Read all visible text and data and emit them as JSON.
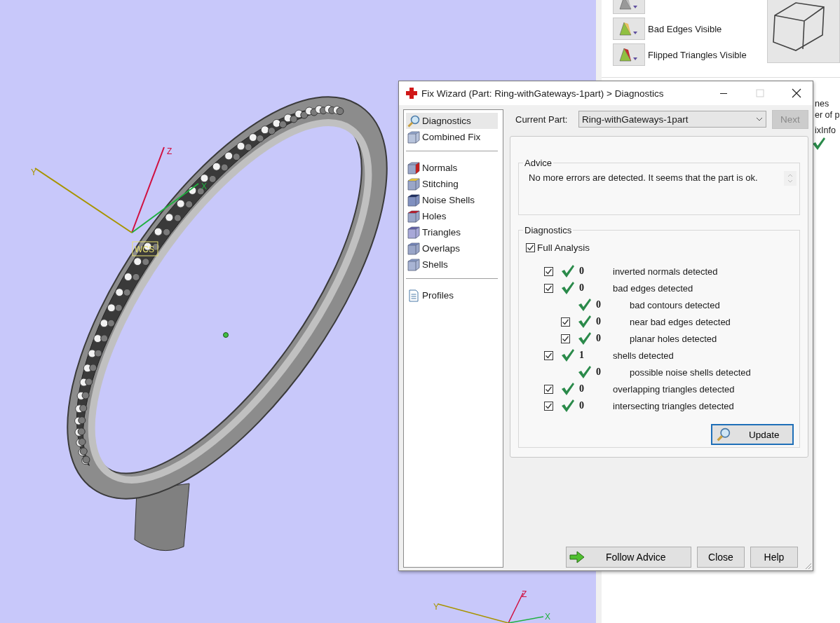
{
  "viewport": {
    "wcs_axes": {
      "labels": [
        "Z",
        "X",
        "Y"
      ],
      "tag": "WCS"
    },
    "corner_axes": {
      "labels": [
        "Z",
        "X",
        "Y"
      ]
    }
  },
  "side_panel": {
    "toggles": [
      {
        "kind": "shaded"
      },
      {
        "kind": "bad-edges",
        "label": "Bad Edges Visible"
      },
      {
        "kind": "flipped",
        "label": "Flipped Triangles Visible"
      }
    ],
    "fragments": [
      "nes",
      "er of p"
    ],
    "column_header": "ixInfo",
    "status_ok": true
  },
  "dialog": {
    "title": "Fix Wizard (Part: Ring-withGateways-1part) > Diagnostics",
    "maximize_disabled": true,
    "nav_groups": [
      [
        {
          "label": "Diagnostics",
          "kind": "search",
          "selected": true
        },
        {
          "label": "Combined Fix",
          "kind": "stack",
          "selected": false
        }
      ],
      [
        {
          "label": "Normals",
          "kind": "normals",
          "selected": false
        },
        {
          "label": "Stitching",
          "kind": "stitching",
          "selected": false
        },
        {
          "label": "Noise Shells",
          "kind": "noise",
          "selected": false
        },
        {
          "label": "Holes",
          "kind": "holes",
          "selected": false
        },
        {
          "label": "Triangles",
          "kind": "triangles",
          "selected": false
        },
        {
          "label": "Overlaps",
          "kind": "overlaps",
          "selected": false
        },
        {
          "label": "Shells",
          "kind": "shells",
          "selected": false
        }
      ],
      [
        {
          "label": "Profiles",
          "kind": "document",
          "selected": false
        }
      ]
    ],
    "current_part_label": "Current Part:",
    "current_part": "Ring-withGateways-1part",
    "next_button": {
      "label": "Next",
      "disabled": true
    },
    "advice": {
      "title": "Advice",
      "text": "No more errors are detected. It seems that the part is ok."
    },
    "diagnostics": {
      "title": "Diagnostics",
      "full_analysis": {
        "label": "Full Analysis",
        "checked": true
      },
      "rows": [
        {
          "kind": "check",
          "checked": true,
          "ok": true,
          "value": "0",
          "label": "inverted normals detected"
        },
        {
          "kind": "check",
          "checked": true,
          "ok": true,
          "value": "0",
          "label": "bad edges detected",
          "children": [
            {
              "kind": "plain",
              "ok": true,
              "value": "0",
              "label": "bad contours detected"
            },
            {
              "kind": "check",
              "checked": true,
              "ok": true,
              "value": "0",
              "label": "near bad edges detected"
            },
            {
              "kind": "check",
              "checked": true,
              "ok": true,
              "value": "0",
              "label": "planar holes detected"
            }
          ]
        },
        {
          "kind": "check",
          "checked": true,
          "ok": true,
          "value": "1",
          "label": "shells detected",
          "children": [
            {
              "kind": "plain",
              "ok": true,
              "value": "0",
              "label": "possible noise shells detected"
            }
          ]
        },
        {
          "kind": "check",
          "checked": true,
          "ok": true,
          "value": "0",
          "label": "overlapping triangles detected"
        },
        {
          "kind": "check",
          "checked": true,
          "ok": true,
          "value": "0",
          "label": "intersecting triangles detected"
        }
      ],
      "update_button": "Update"
    },
    "buttons": [
      {
        "kind": "follow",
        "label": "Follow Advice"
      },
      {
        "kind": "plain",
        "label": "Close"
      },
      {
        "kind": "plain",
        "label": "Help"
      }
    ]
  }
}
